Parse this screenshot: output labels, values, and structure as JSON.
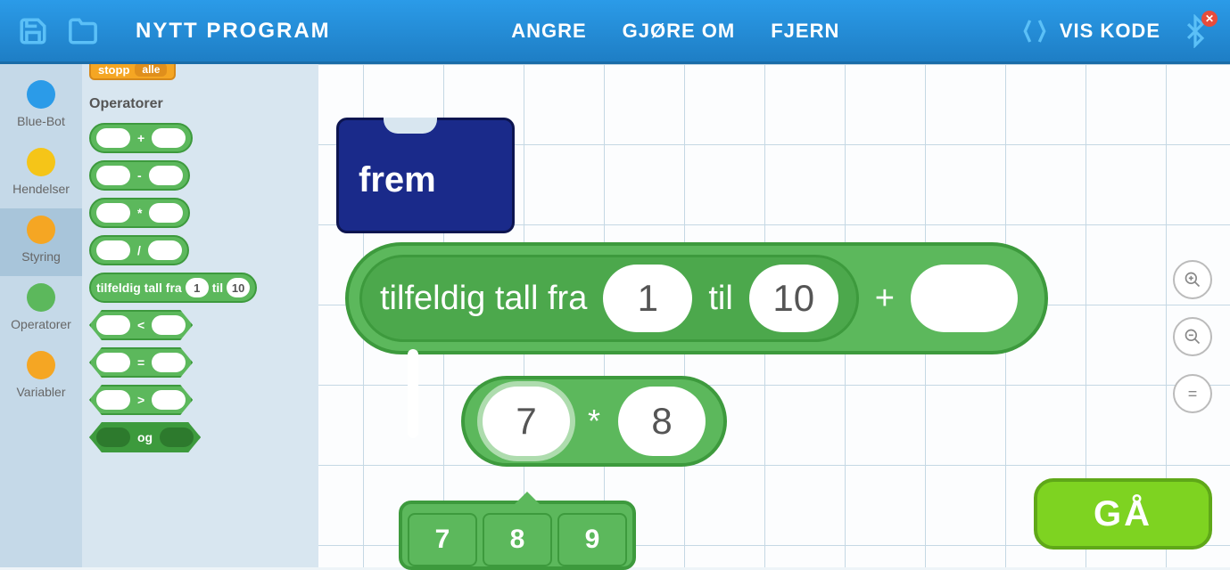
{
  "header": {
    "title": "NYTT PROGRAM",
    "undo": "ANGRE",
    "redo": "GJØRE OM",
    "clear": "FJERN",
    "show_code": "VIS KODE"
  },
  "categories": [
    {
      "id": "bluebot",
      "label": "Blue-Bot",
      "color": "#2b9be8"
    },
    {
      "id": "events",
      "label": "Hendelser",
      "color": "#f5c518"
    },
    {
      "id": "control",
      "label": "Styring",
      "color": "#f5a623"
    },
    {
      "id": "operators",
      "label": "Operatorer",
      "color": "#5cb85c"
    },
    {
      "id": "variables",
      "label": "Variabler",
      "color": "#f5a623"
    }
  ],
  "palette": {
    "stop_label": "stopp",
    "stop_option": "alle",
    "heading": "Operatorer",
    "ops": {
      "plus": "+",
      "minus": "-",
      "mult": "*",
      "div": "/",
      "lt": "<",
      "eq": "=",
      "gt": ">",
      "og": "og"
    },
    "random_label_pre": "tilfeldig tall fra",
    "random_from": "1",
    "random_label_mid": "til",
    "random_to": "10"
  },
  "canvas": {
    "frem": "frem",
    "random_pre": "tilfeldig tall fra",
    "random_from": "1",
    "random_mid": "til",
    "random_to": "10",
    "plus": "+",
    "plus_right": "",
    "mul_left": "7",
    "mul_sym": "*",
    "mul_right": "8",
    "keys": [
      "7",
      "8",
      "9"
    ]
  },
  "controls": {
    "zoom_in": "+",
    "zoom_out": "−",
    "equals": "=",
    "go": "GÅ"
  },
  "icons": {
    "save": "save",
    "open": "open",
    "code": "code",
    "bluetooth": "bluetooth",
    "bt_status": "✕"
  }
}
